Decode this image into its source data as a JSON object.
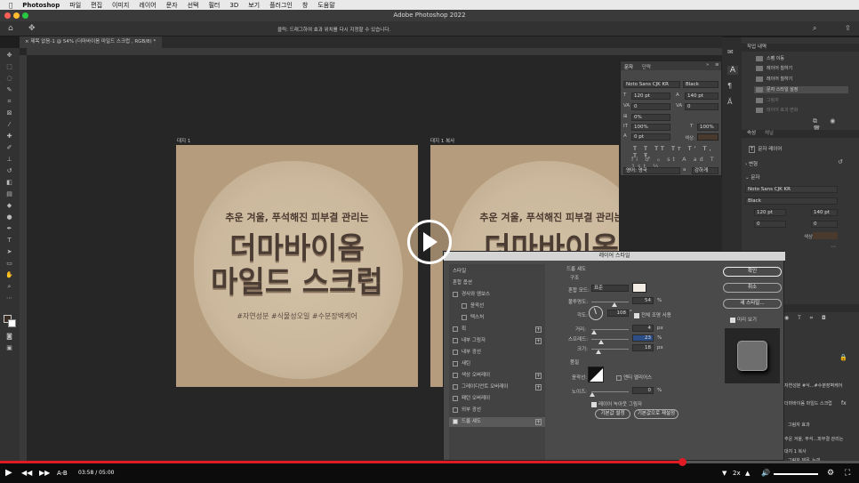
{
  "mac_menu": {
    "app_name": "Photoshop",
    "items": [
      "파일",
      "편집",
      "이미지",
      "레이어",
      "문자",
      "선택",
      "필터",
      "3D",
      "보기",
      "플러그인",
      "창",
      "도움말"
    ]
  },
  "window": {
    "title": "Adobe Photoshop 2022",
    "options_hint": "클릭: 드래그하여 효과 위치를 다시 지정할 수 있습니다.",
    "doc_tab": "제목 없음-1 @ 54% (더마바이옴 마일드 스크럽 , RGB/8) *"
  },
  "artboards": [
    {
      "label": "대지 1",
      "subtitle": "추운 겨울, 푸석해진 피부결 관리는",
      "main_line1": "더마바이옴",
      "main_line2": "마일드 스크럽",
      "tags": "#자연성분 #식물성오일 #수분장벽케어"
    },
    {
      "label": "대지 1 복사",
      "subtitle": "추운 겨울, 푸석해진 피부결 관리는",
      "main_line1": "더마바이옴"
    }
  ],
  "character_panel": {
    "tab_char": "문자",
    "tab_para": "단락",
    "font_family": "Noto Sans CJK KR",
    "font_style": "Black",
    "font_size": "120 pt",
    "leading": "140 pt",
    "kerning": "0",
    "tracking": "0",
    "tsume": "0%",
    "vert_scale": "100%",
    "horiz_scale": "100%",
    "baseline": "0 pt",
    "color_label": "색상:",
    "language": "영어: 영국",
    "antialias": "강하게"
  },
  "history_panel": {
    "title": "작업 내역",
    "items": [
      "스팸 이동",
      "레이어 칠하기",
      "레이어 칠하기",
      "문자 스타일 설정",
      "그림자",
      "레이어 효과 변화"
    ]
  },
  "properties_panel": {
    "tab1": "속성",
    "tab2": "채널",
    "layer_type": "문자 레이어",
    "transform": "변형",
    "char_section": "문자",
    "font_family": "Noto Sans CJK KR",
    "font_style": "Black",
    "font_size": "120 pt",
    "leading": "140 pt",
    "color_label": "색상"
  },
  "layers_snippets": [
    "자연성분 #식...#수분장벽케어",
    "더마바이옴 마일드 스크럽",
    "그림자 효과",
    "추운 겨울, 푸석...피부결 관리는",
    "대지 1 복사",
    "그림자 제목_누끼"
  ],
  "dialog": {
    "title": "레이어 스타일",
    "left_items": [
      {
        "label": "스타일",
        "type": "header"
      },
      {
        "label": "혼합 옵션",
        "type": "header"
      },
      {
        "label": "경사와 엠보스",
        "type": "check"
      },
      {
        "label": "윤곽선",
        "type": "sub"
      },
      {
        "label": "텍스처",
        "type": "sub"
      },
      {
        "label": "획",
        "type": "check",
        "plus": true
      },
      {
        "label": "내부 그림자",
        "type": "check",
        "plus": true
      },
      {
        "label": "내부 광선",
        "type": "check"
      },
      {
        "label": "새틴",
        "type": "check"
      },
      {
        "label": "색상 오버레이",
        "type": "check",
        "plus": true
      },
      {
        "label": "그레이디언트 오버레이",
        "type": "check",
        "plus": true
      },
      {
        "label": "패턴 오버레이",
        "type": "check"
      },
      {
        "label": "외부 광선",
        "type": "check"
      },
      {
        "label": "드롭 섀도",
        "type": "check",
        "plus": true,
        "selected": true
      }
    ],
    "section_title": "드롭 섀도",
    "struct_label": "구조",
    "blend_label": "혼합 모드:",
    "blend_value": "표준",
    "opacity_label": "불투명도:",
    "opacity_value": "54",
    "angle_label": "각도:",
    "angle_value": "108",
    "global_light": "전체 조명 사용",
    "distance_label": "거리:",
    "distance_value": "4",
    "spread_label": "스프레드:",
    "spread_value": "23",
    "size_label": "크기:",
    "size_value": "18",
    "quality_label": "품질",
    "contour_label": "윤곽선:",
    "anti_alias": "앤티 앨리어스",
    "noise_label": "노이즈:",
    "noise_value": "0",
    "knockout": "레이어 녹아웃 그림자",
    "btn_default": "기본값 설정",
    "btn_reset": "기본값으로 재설정",
    "btn_ok": "확인",
    "btn_cancel": "취소",
    "btn_new_style": "새 스타일...",
    "preview_label": "미리 보기",
    "unit_percent": "%",
    "unit_px": "px",
    "unit_deg": "°",
    "shadow_color": "#f3ece4"
  },
  "video": {
    "ab_label": "A-B",
    "current_time": "03:58",
    "duration": "05:00",
    "time_separator": "/",
    "speed": "2x",
    "progress": 0.794
  },
  "colors": {
    "accent_red": "#e01b24",
    "artboard_bg": "#b59c7c"
  }
}
